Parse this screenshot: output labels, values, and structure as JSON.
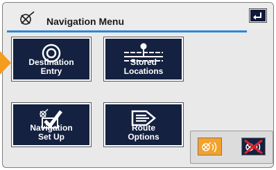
{
  "header": {
    "title": "Navigation Menu"
  },
  "menu": {
    "destination_entry": {
      "line1": "Destination",
      "line2": "Entry"
    },
    "stored_locations": {
      "line1": "Stored",
      "line2": "Locations"
    },
    "navigation_setup": {
      "line1": "Navigation",
      "line2": "Set Up"
    },
    "route_options": {
      "line1": "Route",
      "line2": "Options"
    }
  },
  "colors": {
    "accent": "#2b88d6",
    "tile_bg": "#142140",
    "selector": "#f39c1e",
    "guidance_active": "#f4a12a"
  },
  "icons": {
    "header": "compass-icon",
    "back": "back-arrow-icon",
    "destination": "target-icon",
    "stored": "map-pin-icon",
    "setup": "checkmark-icon",
    "route": "route-arrow-icon",
    "guidance_on": "voice-guidance-on-icon",
    "guidance_off": "voice-guidance-muted-icon"
  }
}
